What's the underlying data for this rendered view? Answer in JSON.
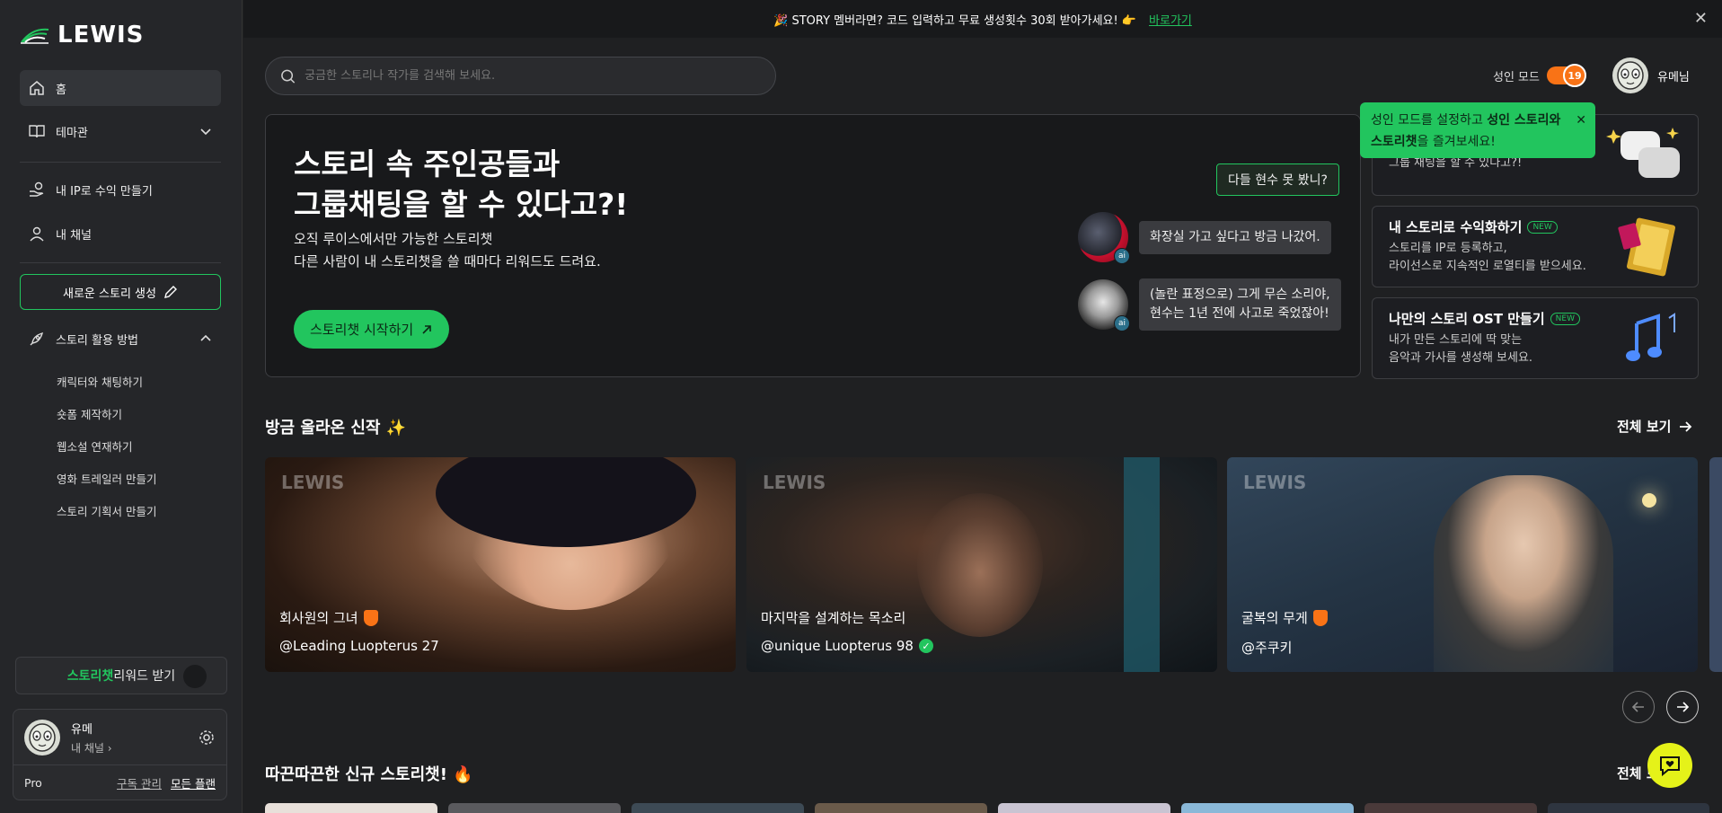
{
  "brand": {
    "name": "LEWIS"
  },
  "sidebar": {
    "home": "홈",
    "theme": "테마관",
    "ip": "내 IP로 수익 만들기",
    "channel": "내 채널",
    "new_story": "새로운 스토리 생성",
    "howto": "스토리 활용 방법",
    "sub_items": [
      "캐릭터와 채팅하기",
      "숏폼 제작하기",
      "웹소설 연재하기",
      "영화 트레일러 만들기",
      "스토리 기획서 만들기"
    ],
    "reward_green": "스토리챗",
    "reward_rest": " 리워드 받기",
    "user": {
      "name": "유메",
      "channel": "내 채널",
      "plan": "Pro",
      "manage": "구독 관리",
      "all_plans": "모든 플랜"
    }
  },
  "top_banner": {
    "text": "🎉 STORY 멤버라면? 코드 입력하고 무료 생성횟수 30회 받아가세요! 👉",
    "link": "바로가기",
    "close": "✕"
  },
  "header": {
    "search_placeholder": "궁금한 스토리나 작가를 검색해 보세요.",
    "adult_label": "성인 모드",
    "adult_badge": "19",
    "user_name": "유메님"
  },
  "tooltip": {
    "pre": "성인 모드를 설정하고 ",
    "bold1": "성인 스토리와",
    "bold2": "스토리챗",
    "post": "을 즐겨보세요!",
    "close": "✕"
  },
  "hero": {
    "title_line1": "스토리 속 주인공들과",
    "title_line2": "그룹채팅을 할 수 있다고?!",
    "desc_line1": "오직 루이스에서만 가능한 스토리챗",
    "desc_line2": "다른 사람이 내 스토리챗을 쓸 때마다 리워드도 드려요.",
    "cta": "스토리챗 시작하기",
    "tag": "다들 현수 못 봤니?",
    "bubble1": "화장실 가고 싶다고 방금 나갔어.",
    "bubble2_line1": "(놀란 표정으로) 그게 무슨 소리야,",
    "bubble2_line2": "현수는 1년 전에 사고로 죽었잖아!",
    "ai_label": "ai"
  },
  "side_cards": [
    {
      "title": "",
      "line1": "",
      "line2": "그룹 채팅을 할 수 있다고?!",
      "new": ""
    },
    {
      "title": "내 스토리로 수익화하기",
      "new": "NEW",
      "line1": "스토리를 IP로 등록하고,",
      "line2": "라이선스로 지속적인 로열티를 받으세요."
    },
    {
      "title": "나만의 스토리 OST 만들기",
      "new": "NEW",
      "line1": "내가 만든 스토리에 딱 맞는",
      "line2": "음악과 가사를 생성해 보세요."
    }
  ],
  "new_works": {
    "title": "방금 올라온 신작 ✨",
    "see_all": "전체 보기",
    "cards": [
      {
        "watermark": "LEWIS",
        "title": "회사원의 그녀",
        "author": "@Leading Luopterus 27",
        "badge": "orange"
      },
      {
        "watermark": "LEWIS",
        "title": "마지막을 설계하는 목소리",
        "author": "@unique Luopterus 98",
        "badge": "green"
      },
      {
        "watermark": "LEWIS",
        "title": "굴복의 무게",
        "author": "@주쿠키",
        "badge": "orange"
      }
    ]
  },
  "hot_chats": {
    "title": "따끈따끈한 신규 스토리챗! 🔥",
    "see_all": "전체 보기"
  },
  "colors": {
    "accent": "#22c55e",
    "orange": "#f97316",
    "fab": "#e5f219"
  }
}
